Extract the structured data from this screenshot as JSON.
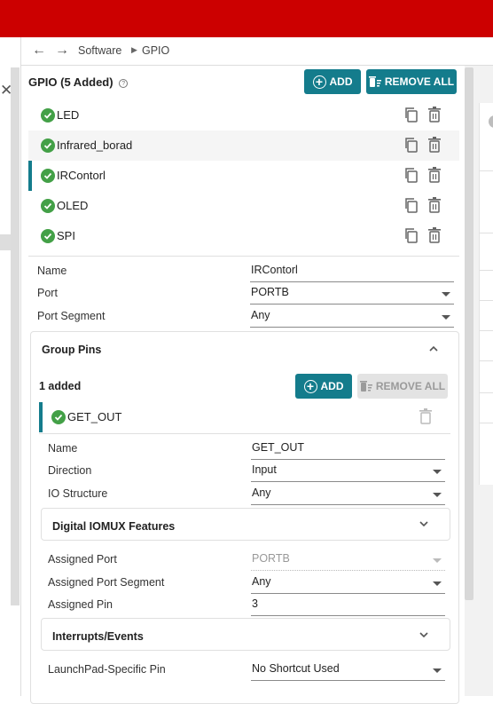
{
  "nav": {
    "back_icon": "arrow-left-icon",
    "forward_icon": "arrow-right-icon",
    "breadcrumb": [
      "Software",
      "GPIO"
    ]
  },
  "gpio": {
    "title": "GPIO (5 Added)",
    "help_icon": "help-circle-icon",
    "add_label": "ADD",
    "remove_all_label": "REMOVE ALL",
    "items": [
      {
        "label": "LED"
      },
      {
        "label": "Infrared_borad"
      },
      {
        "label": "IRContorl"
      },
      {
        "label": "OLED"
      },
      {
        "label": "SPI"
      }
    ],
    "selected_index": 2
  },
  "fields": {
    "name": {
      "label": "Name",
      "value": "IRContorl"
    },
    "port": {
      "label": "Port",
      "value": "PORTB"
    },
    "port_segment": {
      "label": "Port Segment",
      "value": "Any"
    }
  },
  "group_pins": {
    "title": "Group Pins",
    "added_text": "1 added",
    "add_label": "ADD",
    "remove_all_label": "REMOVE ALL",
    "pin": {
      "label": "GET_OUT"
    },
    "fields": {
      "name": {
        "label": "Name",
        "value": "GET_OUT"
      },
      "direction": {
        "label": "Direction",
        "value": "Input"
      },
      "io_structure": {
        "label": "IO Structure",
        "value": "Any"
      }
    },
    "digital_iomux": {
      "title": "Digital IOMUX Features"
    },
    "assigned": {
      "port": {
        "label": "Assigned Port",
        "value": "PORTB"
      },
      "port_segment": {
        "label": "Assigned Port Segment",
        "value": "Any"
      },
      "pin": {
        "label": "Assigned Pin",
        "value": "3"
      }
    },
    "interrupts": {
      "title": "Interrupts/Events"
    },
    "launchpad": {
      "label": "LaunchPad-Specific Pin",
      "value": "No Shortcut Used"
    }
  },
  "colors": {
    "brand_red": "#cc0000",
    "accent_teal": "#147c8c",
    "check_green": "#43a047"
  }
}
